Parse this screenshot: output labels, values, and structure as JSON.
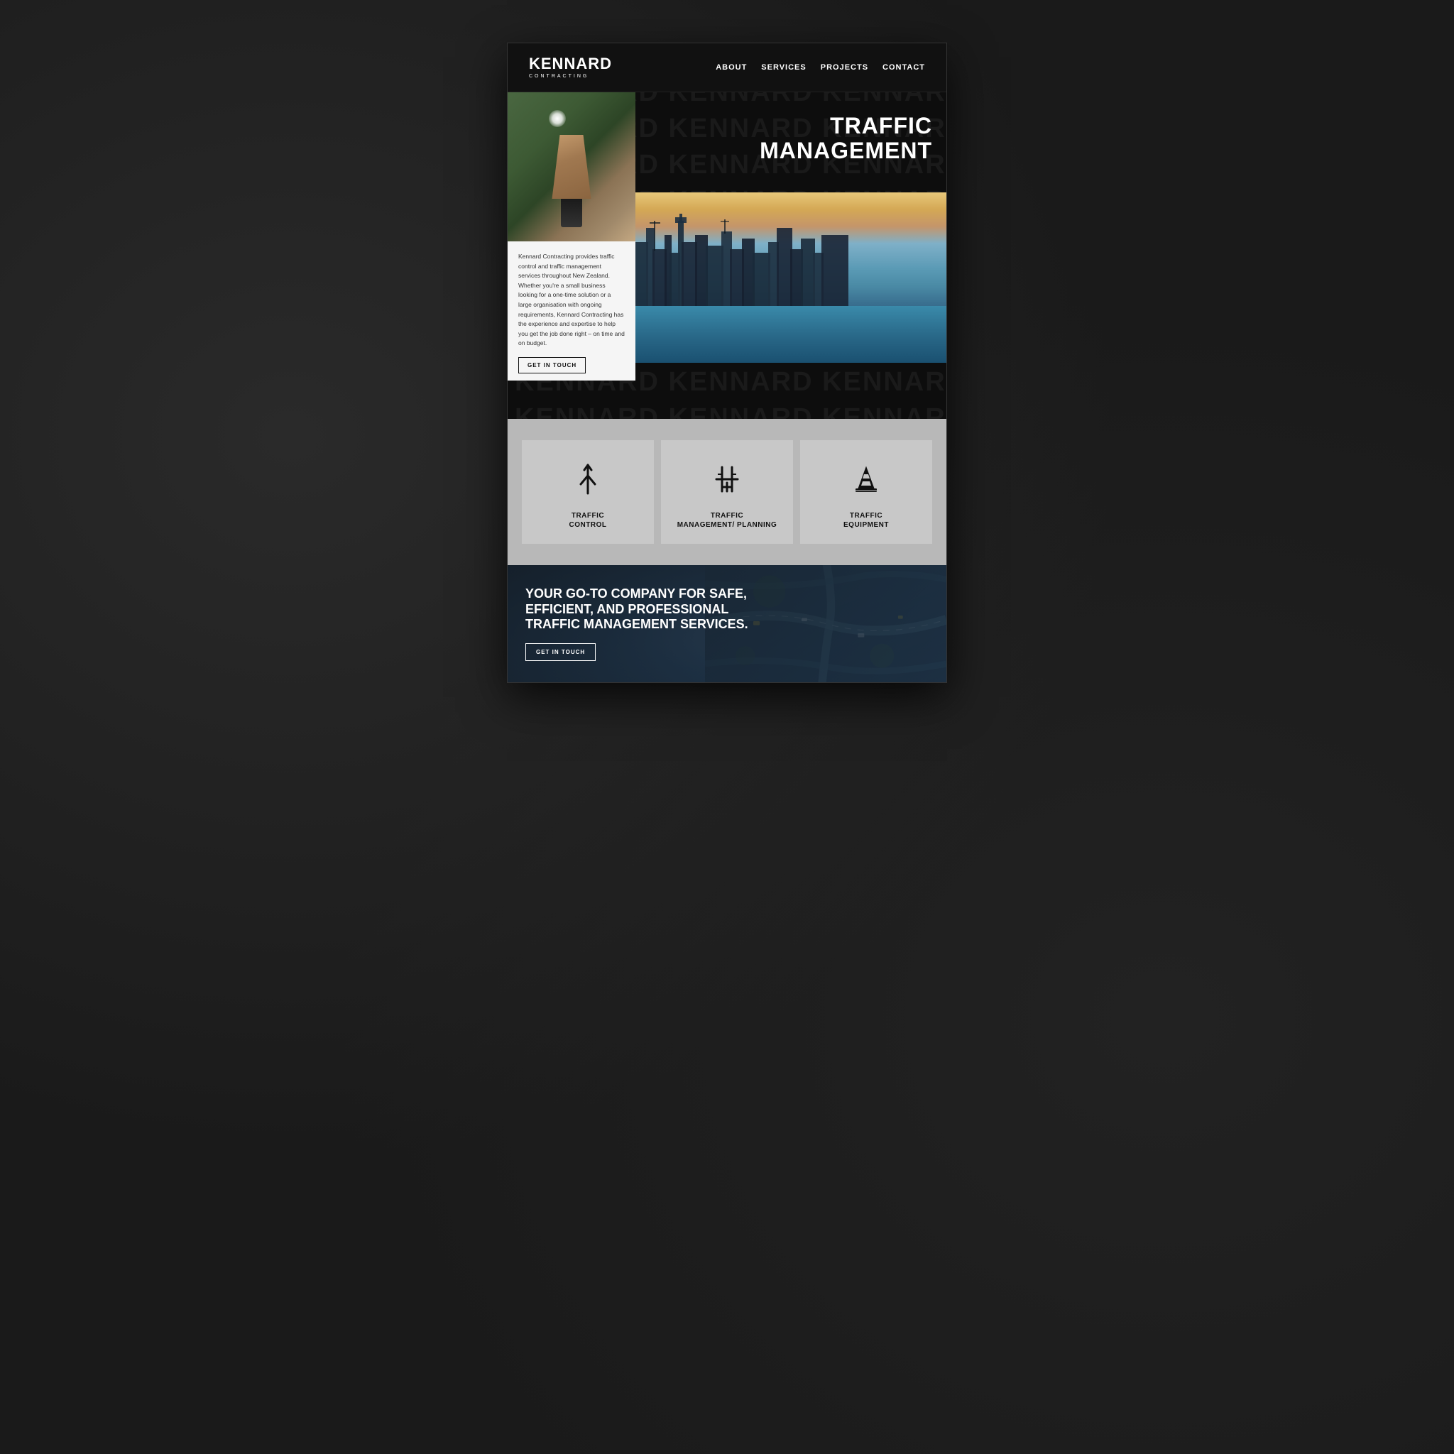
{
  "brand": {
    "name": "KENNARD",
    "sub": "CONTRACTING"
  },
  "nav": {
    "links": [
      {
        "label": "ABOUT",
        "href": "#"
      },
      {
        "label": "SERVICES",
        "href": "#"
      },
      {
        "label": "PROJECTS",
        "href": "#"
      },
      {
        "label": "CONTACT",
        "href": "#"
      }
    ]
  },
  "hero": {
    "bg_text": "KENNARD",
    "title_line1": "TRAFFIC",
    "title_line2": "MANAGEMENT",
    "description": "Kennard Contracting provides traffic control and traffic management services throughout New Zealand. Whether you're a small business looking for a one-time solution or a large organisation with ongoing requirements, Kennard Contracting has the experience and expertise to help you get the job done right – on time and on budget.",
    "cta_label": "GET IN TOUCH"
  },
  "services": {
    "items": [
      {
        "id": "traffic-control",
        "label_line1": "TRAFFIC",
        "label_line2": "CONTROL"
      },
      {
        "id": "traffic-mgmt",
        "label_line1": "TRAFFIC",
        "label_line2": "MANAGEMENT/",
        "label_line3": "PLANNING"
      },
      {
        "id": "traffic-equipment",
        "label_line1": "TRAFFIC",
        "label_line2": "EQUIPMENT"
      }
    ]
  },
  "cta": {
    "title": "YOUR GO-TO COMPANY FOR SAFE, EFFICIENT, AND PROFESSIONAL TRAFFIC MANAGEMENT SERVICES.",
    "button_label": "GET IN TOUCH"
  },
  "icons": {
    "traffic_control": "fork-up-arrow",
    "traffic_mgmt": "traffic-diagram",
    "traffic_equipment": "traffic-cone"
  }
}
